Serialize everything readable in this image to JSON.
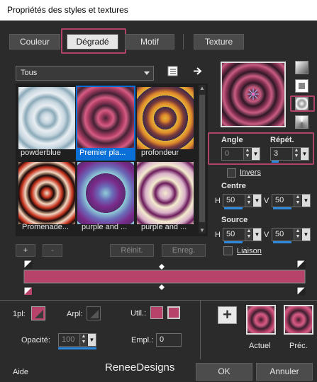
{
  "window": {
    "title": "Propriétés des styles et textures"
  },
  "tabs": [
    {
      "label": "Couleur"
    },
    {
      "label": "Dégradé"
    },
    {
      "label": "Motif"
    },
    {
      "label": "Texture"
    }
  ],
  "filter": {
    "selected": "Tous"
  },
  "gradients": [
    {
      "label": "powderblue"
    },
    {
      "label": "Premier pla..."
    },
    {
      "label": "profondeur"
    },
    {
      "label": "Promenade..."
    },
    {
      "label": "purple and ..."
    },
    {
      "label": "purple and ..."
    }
  ],
  "list_buttons": {
    "add": "+",
    "remove": "-",
    "reset": "Réinit.",
    "save": "Enreg."
  },
  "angle": {
    "label": "Angle",
    "value": "0"
  },
  "repeat": {
    "label": "Répét.",
    "value": "3"
  },
  "invert": {
    "label": "Invers"
  },
  "center": {
    "label": "Centre",
    "h_label": "H",
    "h_value": "50",
    "v_label": "V",
    "v_value": "50"
  },
  "source": {
    "label": "Source",
    "h_label": "H",
    "h_value": "50",
    "v_label": "V",
    "v_value": "50"
  },
  "link": {
    "label": "Liaison"
  },
  "stops": {
    "first_label": "1pl:",
    "bg_label": "Arpl:",
    "use_label": "Util.:",
    "opacity_label": "Opacité:",
    "opacity_value": "100",
    "location_label": "Empl.:",
    "location_value": "0"
  },
  "preview": {
    "current_label": "Actuel",
    "previous_label": "Préc."
  },
  "footer": {
    "help": "Aide",
    "watermark": "ReneeDesigns",
    "ok": "OK",
    "cancel": "Annuler"
  },
  "colors": {
    "accent": "#b04468",
    "stop_color": "#b8436a",
    "selection": "#0a6fd6"
  }
}
